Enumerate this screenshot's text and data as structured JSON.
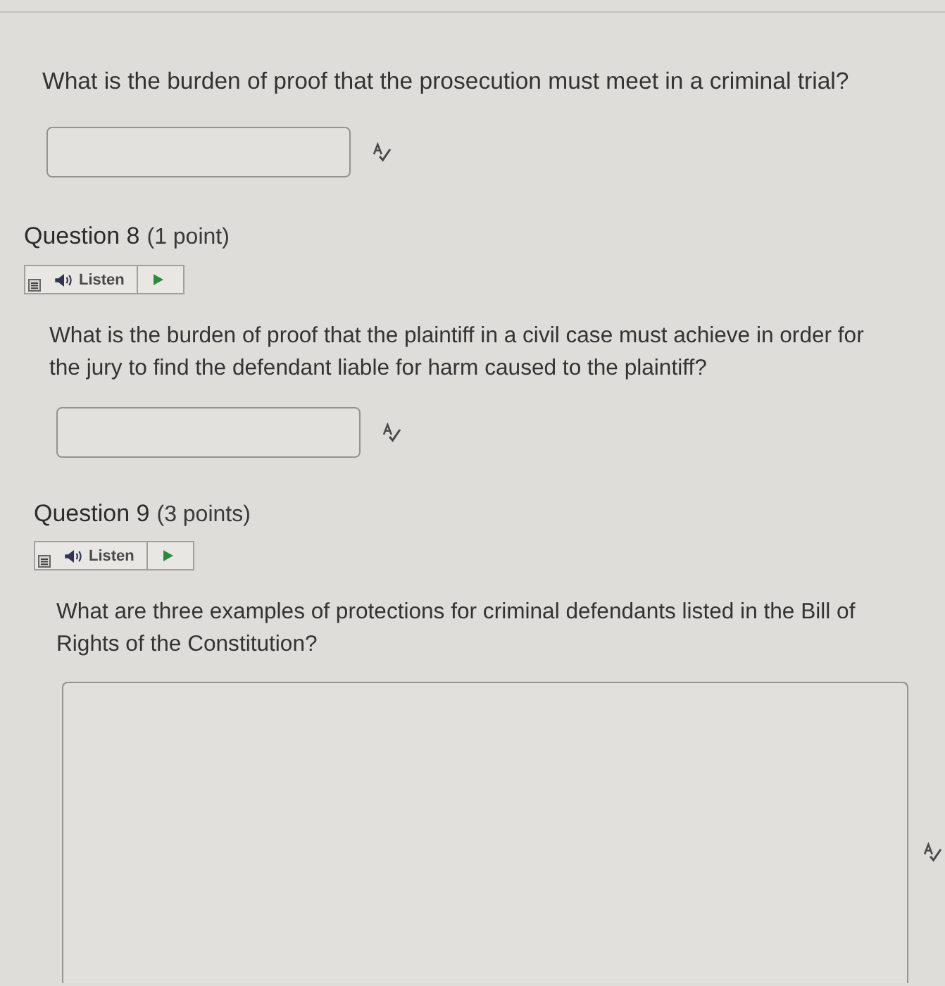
{
  "questions": [
    {
      "prompt": "What is the burden of proof that the prosecution must meet in a criminal trial?",
      "kind": "line"
    },
    {
      "title": "Question 8",
      "points": "(1 point)",
      "listen_label": "Listen",
      "prompt": "What is the burden of proof that the plaintiff in a civil case must achieve in order for the jury to find the defendant liable for harm caused to the plaintiff?",
      "kind": "line"
    },
    {
      "title": "Question 9",
      "points": "(3 points)",
      "listen_label": "Listen",
      "prompt": "What are three examples of protections for criminal defendants listed in the Bill of Rights of the Constitution?",
      "kind": "box"
    }
  ]
}
